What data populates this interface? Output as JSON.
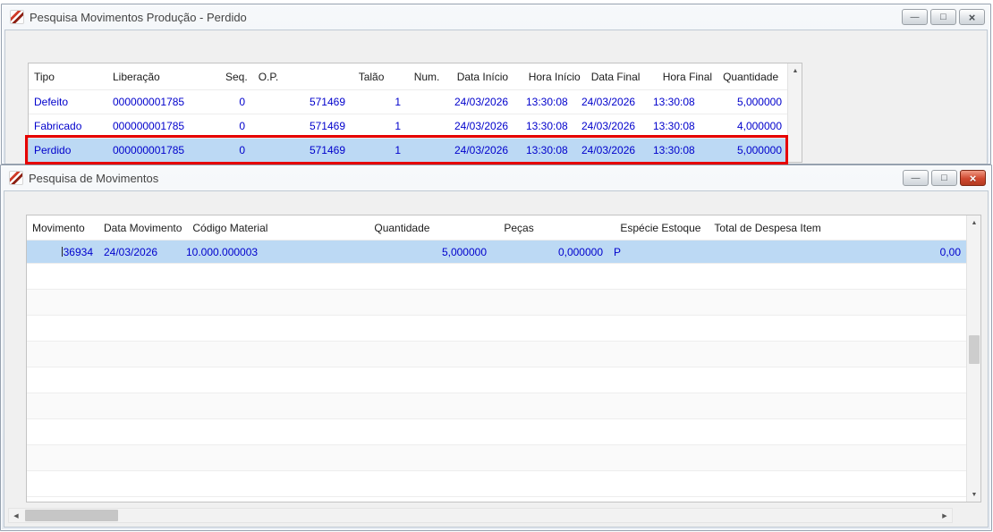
{
  "colors": {
    "selection": "#bcd9f4",
    "value_text": "#0000cc",
    "annotation_red": "#e60000",
    "close_active": "#d0482f"
  },
  "window1": {
    "title": "Pesquisa Movimentos Produção - Perdido",
    "titlebar": {
      "minimize": "—",
      "maximize": "□",
      "close": "×"
    },
    "grid": {
      "columns": [
        "Tipo",
        "Liberação",
        "Seq.",
        "O.P.",
        "Talão",
        "Num.",
        "Data Início",
        "Hora Início",
        "Data Final",
        "Hora Final",
        "Quantidade"
      ],
      "rows": [
        [
          "Defeito",
          "000000001785",
          "0",
          "571469",
          "1",
          "",
          "24/03/2026",
          "13:30:08",
          "24/03/2026",
          "13:30:08",
          "5,000000"
        ],
        [
          "Fabricado",
          "000000001785",
          "0",
          "571469",
          "1",
          "",
          "24/03/2026",
          "13:30:08",
          "24/03/2026",
          "13:30:08",
          "4,000000"
        ],
        [
          "Perdido",
          "000000001785",
          "0",
          "571469",
          "1",
          "",
          "24/03/2026",
          "13:30:08",
          "24/03/2026",
          "13:30:08",
          "5,000000"
        ]
      ],
      "selected_row_index": 2,
      "scrollbar": {
        "up": "▲"
      }
    },
    "annotation": {
      "type": "red-highlight-box",
      "color": "#e60000"
    }
  },
  "window2": {
    "title": "Pesquisa de Movimentos",
    "titlebar": {
      "minimize": "—",
      "maximize": "□",
      "close": "×"
    },
    "grid": {
      "columns": [
        "Movimento",
        "Data Movimento",
        "Código Material",
        "Quantidade",
        "Peças",
        "Espécie Estoque",
        "Total de Despesa Item"
      ],
      "rows": [
        [
          "36934",
          "24/03/2026",
          "10.000.000003",
          "5,000000",
          "0,000000",
          "P",
          "0,00"
        ]
      ],
      "selected_row_index": 0,
      "scrollbar": {
        "up": "▲",
        "down": "▼"
      }
    },
    "hscrollbar": {
      "left": "◀",
      "right": "▶"
    }
  }
}
